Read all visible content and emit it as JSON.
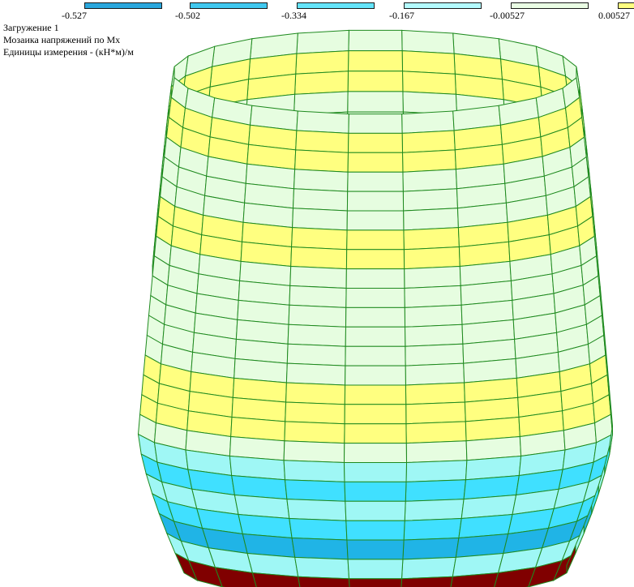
{
  "legend": {
    "ticks": [
      "-0.527",
      "-0.502",
      "-0.334",
      "-0.167",
      "-0.00527",
      "0.00527"
    ],
    "colors": [
      "#2aa7dd",
      "#40c8ef",
      "#64e4fa",
      "#b4fbff",
      "#eafde4",
      "#ffff80"
    ]
  },
  "info": {
    "load_case": "Загружение 1",
    "result_type": "Мозаика напряжений по Mx",
    "units": "Единицы измерения - (кН*м)/м"
  },
  "palette": {
    "mesh_line": "#1f8a1f",
    "pale_green": "#e6fde0",
    "yellow": "#ffff80",
    "light_cyan": "#9ff7f5",
    "cyan": "#40e0ff",
    "blue": "#20b4e6",
    "dark_red": "#800000"
  },
  "bands": {
    "top_to_bottom": [
      "pale_green",
      "yellow",
      "yellow",
      "pale_green",
      "pale_green",
      "pale_green",
      "yellow",
      "yellow",
      "pale_green",
      "pale_green",
      "pale_green",
      "pale_green",
      "pale_green",
      "pale_green",
      "yellow",
      "yellow",
      "yellow",
      "pale_green",
      "light_cyan",
      "cyan",
      "light_cyan",
      "cyan",
      "blue",
      "light_cyan",
      "dark_red"
    ]
  }
}
